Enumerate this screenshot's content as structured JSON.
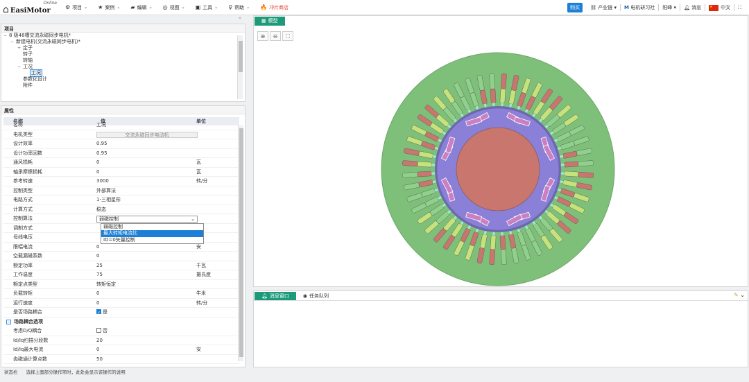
{
  "app": {
    "brand": "EasiMotor",
    "online": "Online"
  },
  "menu": [
    {
      "icon": "⚙",
      "label": "项目",
      "icon_name": "gear-icon"
    },
    {
      "icon": "★",
      "label": "案例",
      "icon_name": "star-icon"
    },
    {
      "icon": "▰",
      "label": "编辑",
      "icon_name": "edit-icon"
    },
    {
      "icon": "◎",
      "label": "视图",
      "icon_name": "view-icon"
    },
    {
      "icon": "▣",
      "label": "工具",
      "icon_name": "toolbox-icon"
    },
    {
      "icon": "♀",
      "label": "帮助",
      "icon_name": "help-icon"
    }
  ],
  "shop": {
    "icon": "🔥",
    "label": "冲片商店"
  },
  "rightnav": {
    "buy": "购买",
    "chain": "产业链",
    "community": "电机研习社",
    "user": "阳峰",
    "messages": "消息",
    "lang": "中文"
  },
  "project_panel": {
    "title": "项目",
    "tree": [
      {
        "indent": 0,
        "toggle": "−",
        "label": "8 极48槽交流永磁同步电机*"
      },
      {
        "indent": 1,
        "toggle": "−",
        "label": "新建电机(交流永磁同步电机)*"
      },
      {
        "indent": 2,
        "toggle": "+",
        "label": "定子"
      },
      {
        "indent": 2,
        "toggle": "",
        "label": "转子"
      },
      {
        "indent": 2,
        "toggle": "",
        "label": "转轴"
      },
      {
        "indent": 2,
        "toggle": "−",
        "label": "工况"
      },
      {
        "indent": 3,
        "toggle": "",
        "label": "工况",
        "selected": true
      },
      {
        "indent": 2,
        "toggle": "",
        "label": "参数化设计"
      },
      {
        "indent": 2,
        "toggle": "",
        "label": "附件"
      }
    ]
  },
  "props_panel": {
    "title": "属性",
    "headers": {
      "name": "名称",
      "value": "值",
      "unit": "单位"
    },
    "rows": [
      {
        "name": "名称",
        "value": "工况",
        "unit": "",
        "partial": true
      },
      {
        "name": "电机类型",
        "value": "交流永磁同步电动机",
        "unit": "",
        "kind": "ghost"
      },
      {
        "name": "设计效率",
        "value": "0.95",
        "unit": ""
      },
      {
        "name": "设计功率因数",
        "value": "0.95",
        "unit": ""
      },
      {
        "name": "通风损耗",
        "value": "0",
        "unit": "瓦"
      },
      {
        "name": "轴承摩擦损耗",
        "value": "0",
        "unit": "瓦"
      },
      {
        "name": "参考转速",
        "value": "3000",
        "unit": "转/分"
      },
      {
        "name": "控制类型",
        "value": "外部算法",
        "unit": ""
      },
      {
        "name": "电路方式",
        "value": "1-三相星形",
        "unit": ""
      },
      {
        "name": "计算方式",
        "value": "稳态",
        "unit": ""
      },
      {
        "name": "控制算法",
        "value": "弱磁控制",
        "unit": "",
        "kind": "select"
      },
      {
        "name": "调制方式",
        "value": "",
        "unit": ""
      },
      {
        "name": "母线电压",
        "value": "",
        "unit": "伏"
      },
      {
        "name": "限幅电流",
        "value": "0",
        "unit": "安"
      },
      {
        "name": "空载漏磁系数",
        "value": "0",
        "unit": ""
      },
      {
        "name": "额定功率",
        "value": "25",
        "unit": "千瓦"
      },
      {
        "name": "工作温度",
        "value": "75",
        "unit": "摄氏度"
      },
      {
        "name": "额定点类型",
        "value": "转矩恒定",
        "unit": ""
      },
      {
        "name": "负载转矩",
        "value": "0",
        "unit": "牛米"
      },
      {
        "name": "运行速度",
        "value": "0",
        "unit": "转/分"
      },
      {
        "name": "是否场路耦合",
        "value": "是",
        "unit": "",
        "kind": "check",
        "checked": true
      }
    ],
    "section2": {
      "title": "场路耦合选项",
      "toggle": "−"
    },
    "rows2": [
      {
        "name": "考虑D/Q耦合",
        "value": "否",
        "unit": "",
        "kind": "check",
        "checked": false
      },
      {
        "name": "Id/Iq扫描分段数",
        "value": "20",
        "unit": ""
      },
      {
        "name": "Id/Iq最大电流",
        "value": "0",
        "unit": "安"
      },
      {
        "name": "齿磁通计算点数",
        "value": "50",
        "unit": ""
      }
    ],
    "dropdown_options": [
      {
        "label": "弱磁控制",
        "highlight": false
      },
      {
        "label": "最大转矩电流比",
        "highlight": true
      },
      {
        "label": "ID=0矢量控制",
        "highlight": false
      }
    ]
  },
  "model_panel": {
    "tab": "模型",
    "tools": [
      "zoom-in-icon",
      "zoom-out-icon",
      "fit-icon"
    ],
    "tool_glyphs": [
      "⊕",
      "⊖",
      "⛶"
    ]
  },
  "message_panel": {
    "tabs": [
      "消息窗口",
      "任务队列"
    ]
  },
  "statusbar": {
    "label": "状态栏",
    "text": "选择上面部分操作项时，此处会显示该操作的说明"
  },
  "colors": {
    "accent": "#1d9a7a",
    "stator": "#7ec07a",
    "rotor_core": "#8a80d8",
    "shaft": "#c8766e",
    "magnet": "#c97fc0",
    "buy": "#1e7fd6"
  },
  "slot_colors": [
    "#c8766e",
    "#c6e27a",
    "#c8766e",
    "#c6e27a",
    "#8fd08a",
    "#8fd08a"
  ]
}
